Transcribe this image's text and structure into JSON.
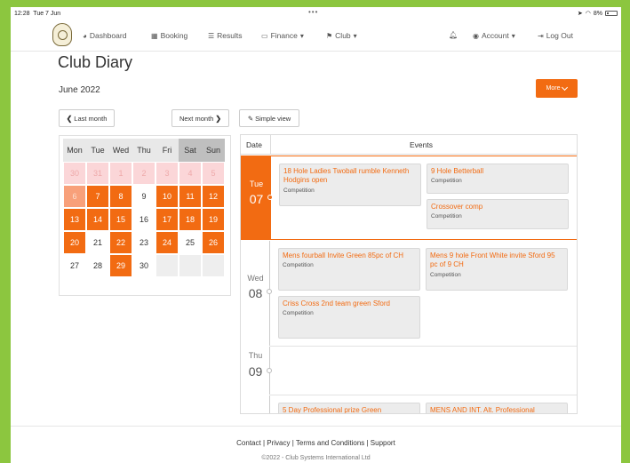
{
  "statusbar": {
    "time": "12:28",
    "date": "Tue 7 Jun",
    "dots": "•••",
    "battery": "8%"
  },
  "nav": {
    "dashboard": "Dashboard",
    "booking": "Booking",
    "results": "Results",
    "finance": "Finance",
    "club": "Club",
    "account": "Account",
    "logout": "Log Out"
  },
  "page": {
    "title": "Club Diary",
    "month": "June 2022",
    "more": "More"
  },
  "controls": {
    "last_month": "Last month",
    "next_month": "Next month",
    "simple_view": "Simple view"
  },
  "calendar": {
    "headers": [
      "Mon",
      "Tue",
      "Wed",
      "Thu",
      "Fri",
      "Sat",
      "Sun"
    ],
    "days": [
      [
        "30",
        "31",
        "1",
        "2",
        "3",
        "4",
        "5"
      ],
      [
        "6",
        "7",
        "8",
        "9",
        "10",
        "11",
        "12"
      ],
      [
        "13",
        "14",
        "15",
        "16",
        "17",
        "18",
        "19"
      ],
      [
        "20",
        "21",
        "22",
        "23",
        "24",
        "25",
        "26"
      ],
      [
        "27",
        "28",
        "29",
        "30",
        "",
        "",
        ""
      ]
    ]
  },
  "events": {
    "header_date": "Date",
    "header_events": "Events",
    "days": [
      {
        "weekday": "Tue",
        "day": "07",
        "cards": [
          {
            "title": "18 Hole Ladies Twoball rumble Kenneth Hodgins open",
            "category": "Competition"
          },
          {
            "title": "9 Hole Betterball",
            "category": "Competition"
          },
          {
            "title": "Crossover comp",
            "category": "Competition"
          }
        ]
      },
      {
        "weekday": "Wed",
        "day": "08",
        "cards": [
          {
            "title": "Mens fourball Invite Green 85pc of CH",
            "category": "Competition"
          },
          {
            "title": "Mens 9 hole Front White invite Sford 95 pc of 9 CH",
            "category": "Competition"
          },
          {
            "title": "Criss Cross 2nd team green Sford",
            "category": "Competition"
          }
        ]
      },
      {
        "weekday": "Thu",
        "day": "09",
        "cards": []
      },
      {
        "weekday": "",
        "day": "",
        "cards": [
          {
            "title": "5 Day Professional prize Green",
            "category": ""
          },
          {
            "title": "MENS AND INT. Alt. Professional",
            "category": ""
          }
        ]
      }
    ]
  },
  "footer": {
    "contact": "Contact",
    "privacy": "Privacy",
    "terms": "Terms and Conditions",
    "support": "Support",
    "copyright": "©2022 - Club Systems International Ltd"
  }
}
